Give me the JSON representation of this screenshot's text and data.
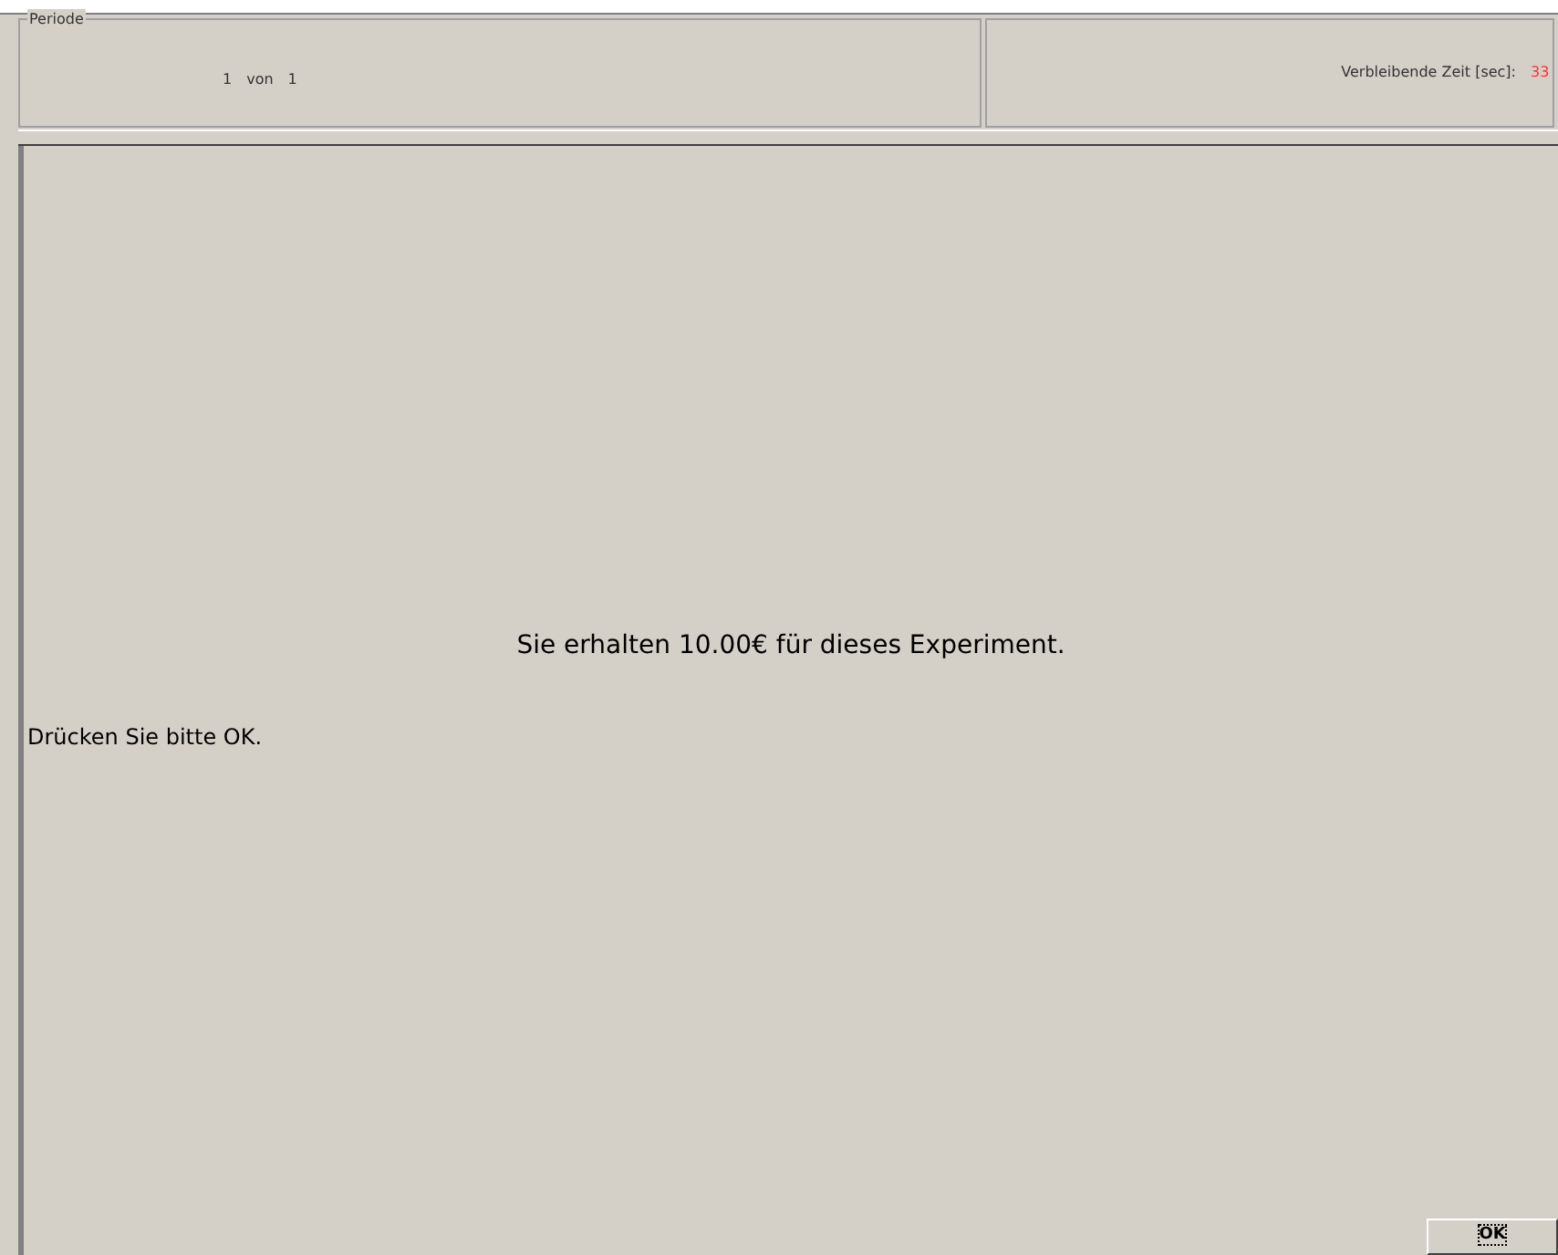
{
  "period_panel": {
    "legend": "Periode",
    "current": "1",
    "separator": "von",
    "total": "1"
  },
  "time_panel": {
    "label": "Verbleibende Zeit [sec]:",
    "value": "33"
  },
  "message": "Sie erhalten 10.00€  für dieses Experiment.",
  "instruction": "Drücken Sie bitte OK.",
  "buttons": [
    {
      "label": "OK",
      "kind": "focused"
    }
  ]
}
